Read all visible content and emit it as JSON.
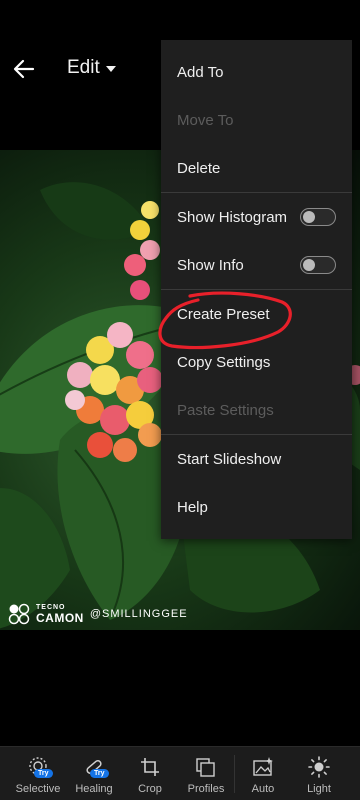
{
  "header": {
    "title": "Edit"
  },
  "menu": {
    "items": [
      {
        "label": "Add To",
        "enabled": true
      },
      {
        "label": "Move To",
        "enabled": false
      },
      {
        "label": "Delete",
        "enabled": true
      },
      {
        "label": "Show Histogram",
        "enabled": true,
        "toggle": false
      },
      {
        "label": "Show Info",
        "enabled": true,
        "toggle": false
      },
      {
        "label": "Create Preset",
        "enabled": true,
        "highlighted": true
      },
      {
        "label": "Copy Settings",
        "enabled": true
      },
      {
        "label": "Paste Settings",
        "enabled": false
      },
      {
        "label": "Start Slideshow",
        "enabled": true
      },
      {
        "label": "Help",
        "enabled": true
      }
    ]
  },
  "photo": {
    "watermark": {
      "brand_small": "TECNO",
      "brand_big": "CAMON",
      "handle": "@SMILLINGGEE"
    }
  },
  "toolbar": {
    "items": [
      {
        "label": "Selective",
        "icon": "selective-icon",
        "badge": "Try"
      },
      {
        "label": "Healing",
        "icon": "healing-icon",
        "badge": "Try"
      },
      {
        "label": "Crop",
        "icon": "crop-icon"
      },
      {
        "label": "Profiles",
        "icon": "profiles-icon"
      },
      {
        "label": "Auto",
        "icon": "auto-icon"
      },
      {
        "label": "Light",
        "icon": "light-icon"
      }
    ]
  },
  "colors": {
    "accent": "#1473e6",
    "menu_bg": "#1f1f1f",
    "annotation": "#e8202a"
  }
}
